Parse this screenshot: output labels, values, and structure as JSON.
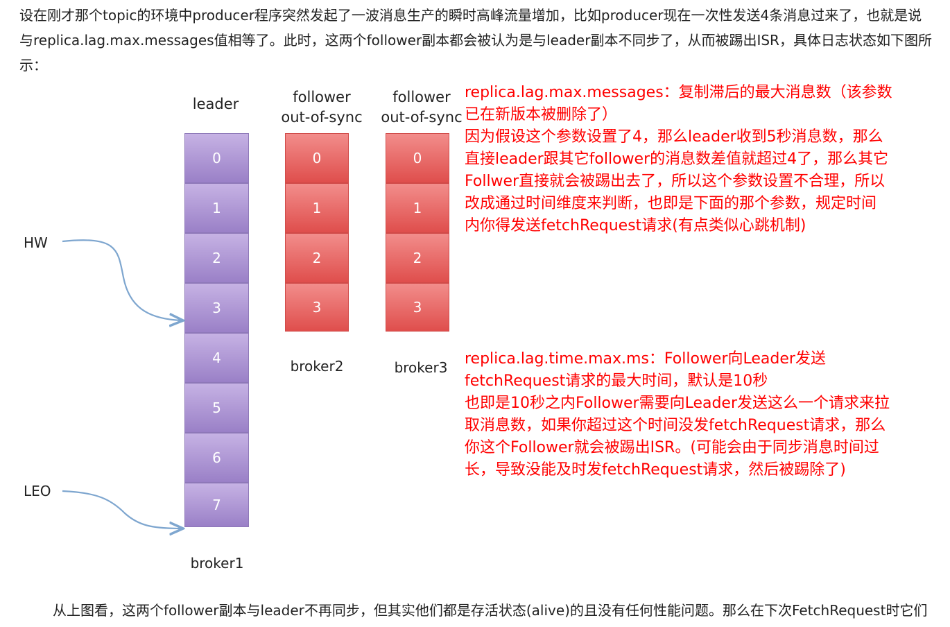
{
  "intro_paragraph": {
    "line1": "设在刚才那个topic的环境中producer程序突然发起了一波消息生产的瞬时高峰流量增加，比如producer现在一次性发送4条消息过来了，也就是说",
    "line2": "与replica.lag.max.messages值相等了。此时，这两个follower副本都会被认为是与leader副本不同步了，从而被踢出ISR，具体日志状态如下图所",
    "line3": "示："
  },
  "diagram": {
    "leader_label": "leader",
    "follower2_label_line1": "follower",
    "follower2_label_line2": "out-of-sync",
    "follower3_label_line1": "follower",
    "follower3_label_line2": "out-of-sync",
    "broker1_label": "broker1",
    "broker2_label": "broker2",
    "broker3_label": "broker3",
    "hw_label": "HW",
    "leo_label": "LEO",
    "leader_cells": [
      "0",
      "1",
      "2",
      "3",
      "4",
      "5",
      "6",
      "7"
    ],
    "broker2_cells": [
      "0",
      "1",
      "2",
      "3"
    ],
    "broker3_cells": [
      "0",
      "1",
      "2",
      "3"
    ],
    "colors": {
      "leader_cell": "#9a80c7",
      "follower_cell": "#df4e4c",
      "arrow": "#7ea6cf"
    }
  },
  "note1": {
    "lines": [
      "replica.lag.max.messages：复制滞后的最大消息数（该参数",
      "已在新版本被删除了）",
      "因为假设这个参数设置了4，那么leader收到5秒消息数，那么",
      "直接leader跟其它follower的消息数差值就超过4了，那么其它",
      "Follwer直接就会被踢出去了，所以这个参数设置不合理，所以",
      "改成通过时间维度来判断，也即是下面的那个参数，规定时间",
      "内你得发送fetchRequest请求(有点类似心跳机制)"
    ],
    "color": "#ff0000"
  },
  "note2": {
    "lines": [
      "replica.lag.time.max.ms：Follower向Leader发送",
      "fetchRequest请求的最大时间，默认是10秒",
      "也即是10秒之内Follower需要向Leader发送这么一个请求来拉",
      "取消息数，如果你超过这个时间没发fetchRequest请求，那么",
      "你这个Follower就会被踢出ISR。(可能会由于同步消息时间过",
      "长，导致没能及时发fetchRequest请求，然后被踢除了)"
    ]
  },
  "outro_paragraph": "从上图看，这两个follower副本与leader不再同步，但其实他们都是存活状态(alive)的且没有任何性能问题。那么在下次FetchRequest时它们"
}
